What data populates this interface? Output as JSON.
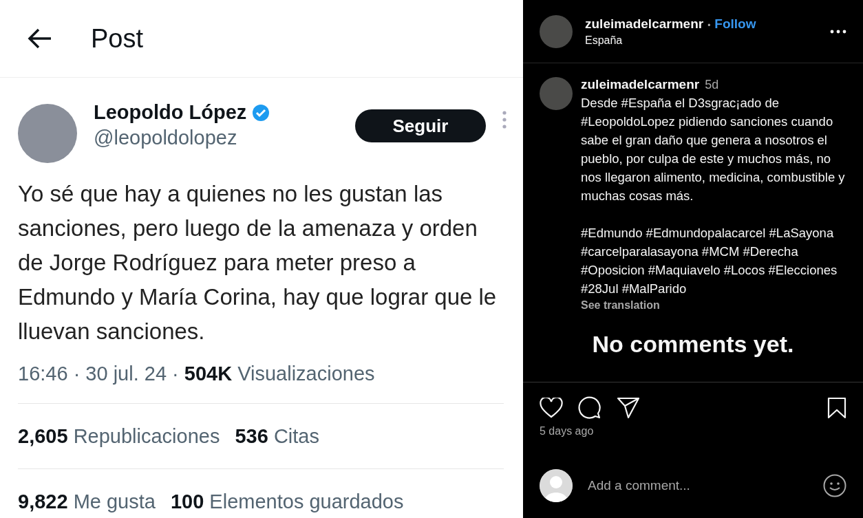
{
  "tweet_screenshot": {
    "header": {
      "title": "Post"
    },
    "author": {
      "name": "Leopoldo López",
      "handle": "@leopoldolopez",
      "follow_button": "Seguir"
    },
    "text": "Yo sé que hay a quienes no les gustan las sanciones, pero luego de la amenaza y orden de Jorge Rodríguez para meter preso a Edmundo y María Corina, hay que lograr que le lluevan sanciones.",
    "meta": {
      "time": "16:46 · 30 jul. 24 · ",
      "views_count": "504K",
      "views_label": "Visualizaciones"
    },
    "stats": [
      {
        "count": "2,605",
        "label": "Republicaciones"
      },
      {
        "count": "536",
        "label": "Citas"
      }
    ],
    "stats_2": [
      {
        "count": "9,822",
        "label": "Me gusta"
      },
      {
        "count": "100",
        "label": "Elementos guardados"
      }
    ]
  },
  "post_panel": {
    "header": {
      "username": "zuleimadelcarmenr",
      "separator": "•",
      "follow": "Follow",
      "location": "España"
    },
    "caption": {
      "username": "zuleimadelcarmenr",
      "age": "5d",
      "text": "Desde #España el D3sgrac¡ado de #LeopoldoLopez pidiendo sanciones cuando sabe el gran daño que genera a nosotros el pueblo, por culpa de este y muchos más, no nos llegaron alimento, medicina, combustible y muchas cosas más.\n\n#Edmundo #Edmundopalacarcel #LaSayona #carcelparalasayona #MCM #Derecha #Oposicion #Maquiavelo #Locos #Elecciones #28Jul #MalParido",
      "see_translation": "See translation"
    },
    "empty_comments": "No comments yet.",
    "date": "5 days ago",
    "comment_field": {
      "placeholder": "Add a comment..."
    }
  }
}
